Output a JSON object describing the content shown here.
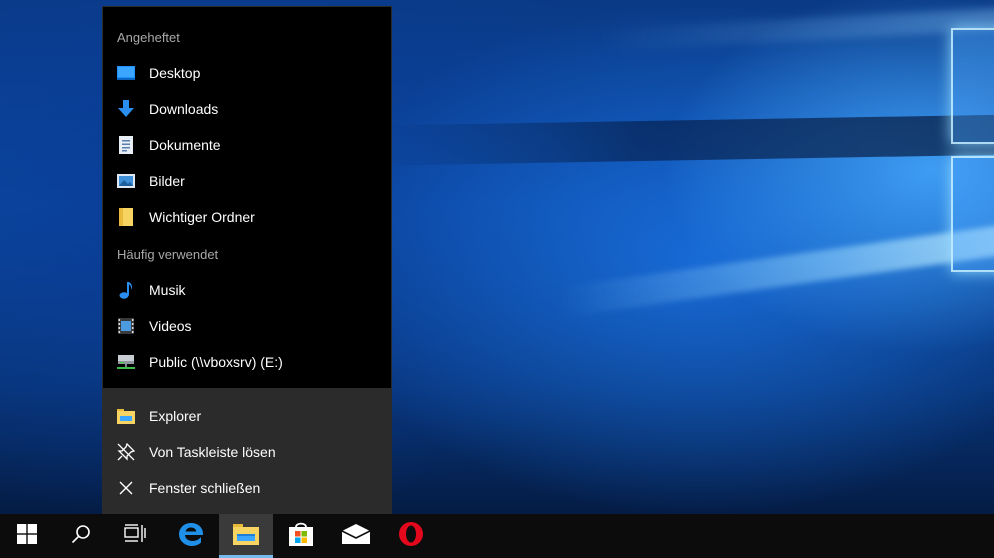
{
  "jumplist": {
    "pinned_title": "Angeheftet",
    "pinned": [
      {
        "label": "Desktop",
        "icon": "desktop-icon"
      },
      {
        "label": "Downloads",
        "icon": "download-arrow-icon"
      },
      {
        "label": "Dokumente",
        "icon": "document-icon"
      },
      {
        "label": "Bilder",
        "icon": "pictures-icon"
      },
      {
        "label": "Wichtiger Ordner",
        "icon": "folder-icon"
      }
    ],
    "frequent_title": "Häufig verwendet",
    "frequent": [
      {
        "label": "Musik",
        "icon": "music-note-icon"
      },
      {
        "label": "Videos",
        "icon": "video-film-icon"
      },
      {
        "label": "Public (\\\\vboxsrv) (E:)",
        "icon": "network-drive-icon"
      }
    ],
    "actions": [
      {
        "label": "Explorer",
        "icon": "file-explorer-icon"
      },
      {
        "label": "Von Taskleiste lösen",
        "icon": "unpin-icon"
      },
      {
        "label": "Fenster schließen",
        "icon": "close-icon"
      }
    ]
  },
  "taskbar": {
    "items": [
      {
        "name": "start-button",
        "icon": "windows-logo-icon",
        "active": false
      },
      {
        "name": "search-button",
        "icon": "search-icon",
        "active": false
      },
      {
        "name": "task-view-button",
        "icon": "task-view-icon",
        "active": false
      },
      {
        "name": "edge-button",
        "icon": "edge-icon",
        "active": false
      },
      {
        "name": "file-explorer-button",
        "icon": "file-explorer-icon",
        "active": true
      },
      {
        "name": "store-button",
        "icon": "store-icon",
        "active": false
      },
      {
        "name": "mail-button",
        "icon": "mail-icon",
        "active": false
      },
      {
        "name": "opera-button",
        "icon": "opera-icon",
        "active": false
      }
    ]
  },
  "colors": {
    "accent": "#76b9ed",
    "jumplist_bg": "#000000",
    "actions_bg": "#2b2b2b",
    "taskbar_bg": "#0c0c0c"
  }
}
